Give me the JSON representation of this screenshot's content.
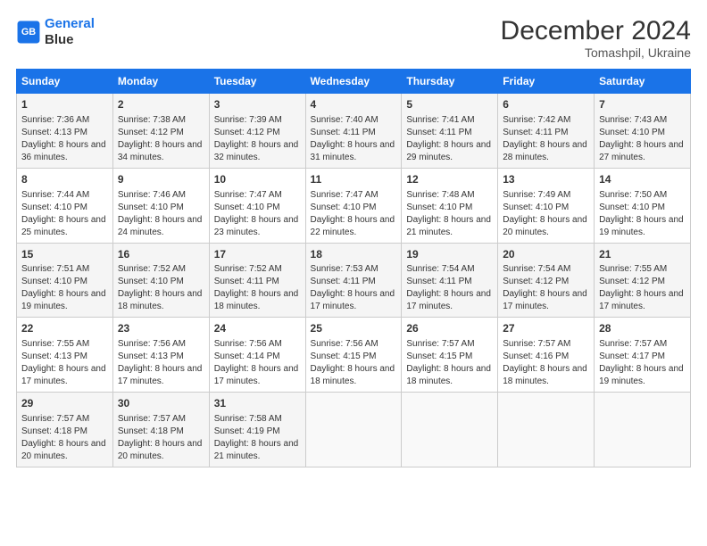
{
  "header": {
    "logo_line1": "General",
    "logo_line2": "Blue",
    "title": "December 2024",
    "subtitle": "Tomashpil, Ukraine"
  },
  "days_of_week": [
    "Sunday",
    "Monday",
    "Tuesday",
    "Wednesday",
    "Thursday",
    "Friday",
    "Saturday"
  ],
  "weeks": [
    [
      {
        "day": "1",
        "sunrise": "7:36 AM",
        "sunset": "4:13 PM",
        "daylight": "8 hours and 36 minutes."
      },
      {
        "day": "2",
        "sunrise": "7:38 AM",
        "sunset": "4:12 PM",
        "daylight": "8 hours and 34 minutes."
      },
      {
        "day": "3",
        "sunrise": "7:39 AM",
        "sunset": "4:12 PM",
        "daylight": "8 hours and 32 minutes."
      },
      {
        "day": "4",
        "sunrise": "7:40 AM",
        "sunset": "4:11 PM",
        "daylight": "8 hours and 31 minutes."
      },
      {
        "day": "5",
        "sunrise": "7:41 AM",
        "sunset": "4:11 PM",
        "daylight": "8 hours and 29 minutes."
      },
      {
        "day": "6",
        "sunrise": "7:42 AM",
        "sunset": "4:11 PM",
        "daylight": "8 hours and 28 minutes."
      },
      {
        "day": "7",
        "sunrise": "7:43 AM",
        "sunset": "4:10 PM",
        "daylight": "8 hours and 27 minutes."
      }
    ],
    [
      {
        "day": "8",
        "sunrise": "7:44 AM",
        "sunset": "4:10 PM",
        "daylight": "8 hours and 25 minutes."
      },
      {
        "day": "9",
        "sunrise": "7:46 AM",
        "sunset": "4:10 PM",
        "daylight": "8 hours and 24 minutes."
      },
      {
        "day": "10",
        "sunrise": "7:47 AM",
        "sunset": "4:10 PM",
        "daylight": "8 hours and 23 minutes."
      },
      {
        "day": "11",
        "sunrise": "7:47 AM",
        "sunset": "4:10 PM",
        "daylight": "8 hours and 22 minutes."
      },
      {
        "day": "12",
        "sunrise": "7:48 AM",
        "sunset": "4:10 PM",
        "daylight": "8 hours and 21 minutes."
      },
      {
        "day": "13",
        "sunrise": "7:49 AM",
        "sunset": "4:10 PM",
        "daylight": "8 hours and 20 minutes."
      },
      {
        "day": "14",
        "sunrise": "7:50 AM",
        "sunset": "4:10 PM",
        "daylight": "8 hours and 19 minutes."
      }
    ],
    [
      {
        "day": "15",
        "sunrise": "7:51 AM",
        "sunset": "4:10 PM",
        "daylight": "8 hours and 19 minutes."
      },
      {
        "day": "16",
        "sunrise": "7:52 AM",
        "sunset": "4:10 PM",
        "daylight": "8 hours and 18 minutes."
      },
      {
        "day": "17",
        "sunrise": "7:52 AM",
        "sunset": "4:11 PM",
        "daylight": "8 hours and 18 minutes."
      },
      {
        "day": "18",
        "sunrise": "7:53 AM",
        "sunset": "4:11 PM",
        "daylight": "8 hours and 17 minutes."
      },
      {
        "day": "19",
        "sunrise": "7:54 AM",
        "sunset": "4:11 PM",
        "daylight": "8 hours and 17 minutes."
      },
      {
        "day": "20",
        "sunrise": "7:54 AM",
        "sunset": "4:12 PM",
        "daylight": "8 hours and 17 minutes."
      },
      {
        "day": "21",
        "sunrise": "7:55 AM",
        "sunset": "4:12 PM",
        "daylight": "8 hours and 17 minutes."
      }
    ],
    [
      {
        "day": "22",
        "sunrise": "7:55 AM",
        "sunset": "4:13 PM",
        "daylight": "8 hours and 17 minutes."
      },
      {
        "day": "23",
        "sunrise": "7:56 AM",
        "sunset": "4:13 PM",
        "daylight": "8 hours and 17 minutes."
      },
      {
        "day": "24",
        "sunrise": "7:56 AM",
        "sunset": "4:14 PM",
        "daylight": "8 hours and 17 minutes."
      },
      {
        "day": "25",
        "sunrise": "7:56 AM",
        "sunset": "4:15 PM",
        "daylight": "8 hours and 18 minutes."
      },
      {
        "day": "26",
        "sunrise": "7:57 AM",
        "sunset": "4:15 PM",
        "daylight": "8 hours and 18 minutes."
      },
      {
        "day": "27",
        "sunrise": "7:57 AM",
        "sunset": "4:16 PM",
        "daylight": "8 hours and 18 minutes."
      },
      {
        "day": "28",
        "sunrise": "7:57 AM",
        "sunset": "4:17 PM",
        "daylight": "8 hours and 19 minutes."
      }
    ],
    [
      {
        "day": "29",
        "sunrise": "7:57 AM",
        "sunset": "4:18 PM",
        "daylight": "8 hours and 20 minutes."
      },
      {
        "day": "30",
        "sunrise": "7:57 AM",
        "sunset": "4:18 PM",
        "daylight": "8 hours and 20 minutes."
      },
      {
        "day": "31",
        "sunrise": "7:58 AM",
        "sunset": "4:19 PM",
        "daylight": "8 hours and 21 minutes."
      },
      null,
      null,
      null,
      null
    ]
  ]
}
